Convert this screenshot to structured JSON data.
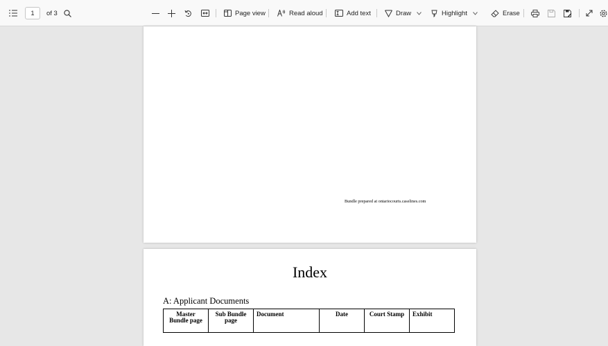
{
  "toolbar": {
    "page_number": "1",
    "page_count": "of 3",
    "page_view_label": "Page view",
    "read_aloud_label": "Read aloud",
    "add_text_label": "Add text",
    "draw_label": "Draw",
    "highlight_label": "Highlight",
    "erase_label": "Erase",
    "icons": [
      "contents-icon",
      "search-icon",
      "zoom-out-icon",
      "zoom-in-icon",
      "rotate-icon",
      "fit-page-icon",
      "page-view-icon",
      "read-aloud-icon",
      "add-text-icon",
      "draw-icon",
      "highlight-icon",
      "erase-icon",
      "print-icon",
      "save-icon",
      "save-as-icon",
      "fullscreen-icon",
      "settings-icon"
    ]
  },
  "page1": {
    "footer_note": "Bundle prepared at ontariocourts.caselines.com"
  },
  "page2": {
    "title": "Index",
    "section": "A: Applicant Documents",
    "table_headers": [
      "Master Bundle page",
      "Sub Bundle page",
      "Document",
      "Date",
      "Court Stamp",
      "Exhibit"
    ]
  }
}
